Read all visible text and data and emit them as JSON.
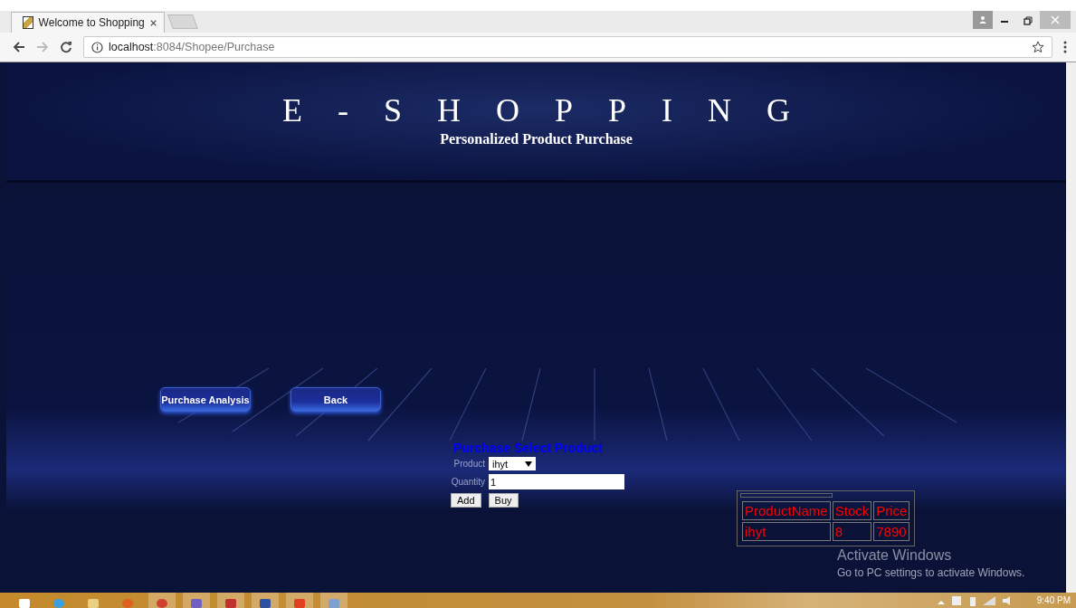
{
  "browser": {
    "tab_title": "Welcome to Shopping",
    "url_host": "localhost",
    "url_path": ":8084/Shopee/Purchase"
  },
  "header": {
    "title": "E-SHOPPING",
    "subtitle": "Personalized Product Purchase"
  },
  "nav_buttons": [
    "Purchase Analysis",
    "Back"
  ],
  "form": {
    "title": "Purchase Select Product",
    "product_label": "Product",
    "product_value": "ihyt",
    "quantity_label": "Quantity",
    "quantity_value": "1",
    "buttons": [
      "Add",
      "Buy"
    ]
  },
  "table": {
    "columns": [
      "ProductName",
      "Stock",
      "Price"
    ],
    "rows": [
      [
        "ihyt",
        "8",
        "7890"
      ]
    ]
  },
  "activation": {
    "title": "Activate Windows",
    "message": "Go to PC settings to activate Windows."
  },
  "taskbar": {
    "time": "9:40 PM"
  }
}
